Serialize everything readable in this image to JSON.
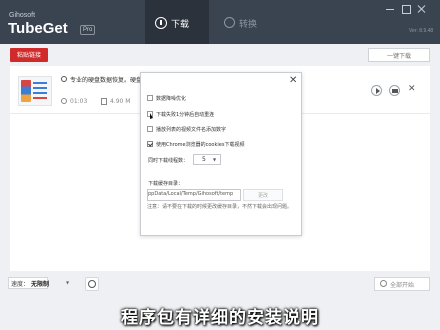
{
  "app": {
    "brand_small": "Gihosoft",
    "brand_name": "TubeGet",
    "badge": "Pro",
    "version": "Ver: 8.9.48"
  },
  "tabs": {
    "download": "下载",
    "convert": "转换"
  },
  "toolbar": {
    "paste_link": "粘贴链接",
    "download_all": "一键下载"
  },
  "video": {
    "title": "专业的硬盘数据恢复。硬盘",
    "duration": "01:03",
    "size": "4.90 M"
  },
  "settings_dialog": {
    "options": [
      {
        "label": "数据降噪优化",
        "checked": false
      },
      {
        "label": "下载失败1分钟后自动重连",
        "checked": false
      },
      {
        "label": "播放列表的视频文件名添加数字",
        "checked": false
      },
      {
        "label": "使用Chrome浏览器的cookies下载视频",
        "checked": true
      }
    ],
    "threads_label": "同时下载线程数：",
    "threads_value": "5",
    "cache_label": "下载缓存目录：",
    "cache_path": "ppData/Local/Temp/Gihosoft/temp",
    "change_button": "更改",
    "cache_note": "注意：请不要在下载的时候更改缓存目录，不然下载会出现问题。"
  },
  "bottom": {
    "speed_label": "速度：",
    "speed_value": "无限制",
    "start_all": "全部开始"
  },
  "caption": "程序包有详细的安装说明",
  "colors": {
    "header": "#3a4350",
    "accent_red": "#d12a2a"
  }
}
